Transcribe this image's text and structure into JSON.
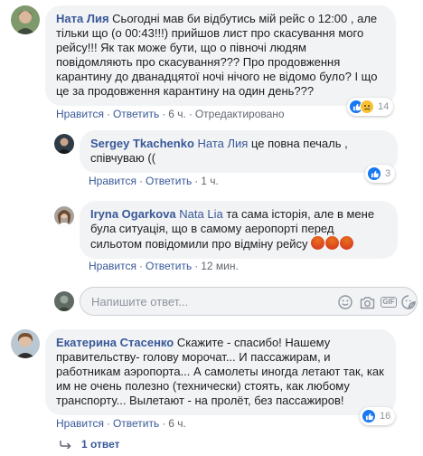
{
  "comments": [
    {
      "author": "Ната Лия",
      "mention": "",
      "text": "Сьогодні мав би відбутись мій рейс о 12:00 , але тільки що (о 00:43!!!) прийшов лист про скасування мого рейсу!!! Як так може бути, що о півночі людям повідомляють про скасування??? Про продовження карантину до дванадцятої ночі нічого не відомо було? І що це за продовження карантину на один день???",
      "like_label": "Нравится",
      "reply_label": "Ответить",
      "time": "6 ч.",
      "edited": "Отредактировано",
      "reaction_count": "14",
      "reaction_icons": [
        "like-icon",
        "sad-icon"
      ]
    },
    {
      "author": "Sergey Tkachenko",
      "mention": "Ната Лия",
      "text": "це повна печаль , співчуваю ((",
      "like_label": "Нравится",
      "reply_label": "Ответить",
      "time": "1 ч.",
      "reaction_count": "3",
      "reaction_icons": [
        "like-icon"
      ]
    },
    {
      "author": "Iryna Ogarkova",
      "mention": "Nata Lia",
      "text": "та сама історія, але в мене була ситуація, що в самому аеропорті перед сильотом повідомили про відміну рейсу",
      "emoji": [
        "angry-icon",
        "angry-icon",
        "angry-icon"
      ],
      "like_label": "Нравится",
      "reply_label": "Ответить",
      "time": "12 мин."
    },
    {
      "author": "Екатерина Стасенко",
      "mention": "",
      "text": "Скажите - спасибо! Нашему правительству- голову морочат... И пассажирам, и работникам аэропорта... А самолеты иногда летают так, как им не очень полезно (технически) стоять, как любому транспорту... Вылетают - на пролёт, без пассажиров!",
      "like_label": "Нравится",
      "reply_label": "Ответить",
      "time": "6 ч.",
      "reaction_count": "16",
      "reaction_icons": [
        "like-icon"
      ]
    }
  ],
  "composer": {
    "placeholder": "Напишите ответ...",
    "icons": [
      "emoji-icon",
      "camera-icon",
      "gif-icon",
      "sticker-icon"
    ]
  },
  "replies_link": "1 ответ",
  "colors": {
    "link": "#385898",
    "bubble": "#f2f3f5",
    "like_blue": "#1877f2",
    "meta_gray": "#606770"
  }
}
